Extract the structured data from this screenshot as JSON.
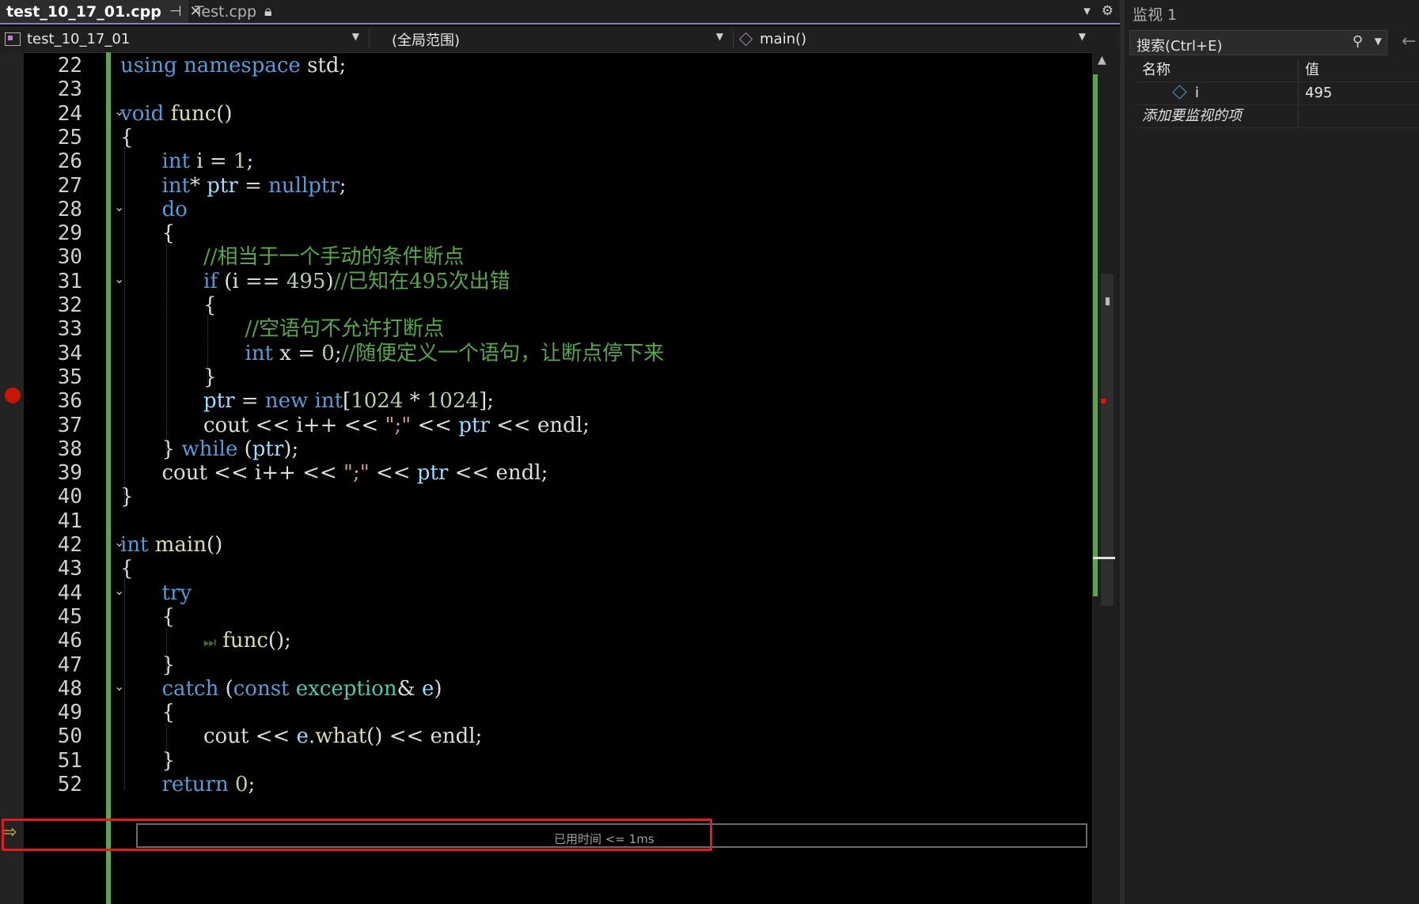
{
  "tabs": [
    {
      "label": "test_10_17_01.cpp",
      "icons": [
        "pin-icon",
        "close-icon"
      ]
    },
    {
      "label": "Test.cpp",
      "icons": [
        "lock-icon"
      ]
    }
  ],
  "navbar": {
    "project": "test_10_17_01",
    "scope": "(全局范围)",
    "function": "main()"
  },
  "code_lines": [
    {
      "n": "22",
      "text": "using namespace std;"
    },
    {
      "n": "23",
      "text": ""
    },
    {
      "n": "24",
      "text": "void func()"
    },
    {
      "n": "25",
      "text": "{"
    },
    {
      "n": "26",
      "text": "int i = 1;"
    },
    {
      "n": "27",
      "text": "int* ptr = nullptr;"
    },
    {
      "n": "28",
      "text": "do"
    },
    {
      "n": "29",
      "text": "{"
    },
    {
      "n": "30",
      "text": "//相当于一个手动的条件断点"
    },
    {
      "n": "31",
      "text": "if (i == 495)//已知在495次出错"
    },
    {
      "n": "32",
      "text": "{"
    },
    {
      "n": "33",
      "text": "//空语句不允许打断点"
    },
    {
      "n": "34",
      "text": "int x = 0;//随便定义一个语句，让断点停下来"
    },
    {
      "n": "35",
      "text": "}"
    },
    {
      "n": "36",
      "text": "ptr = new int[1024 * 1024];"
    },
    {
      "n": "37",
      "text": "cout << i++ << \";\" << ptr << endl;"
    },
    {
      "n": "38",
      "text": "} while (ptr);"
    },
    {
      "n": "39",
      "text": "cout << i++ << \";\" << ptr << endl;"
    },
    {
      "n": "40",
      "text": "}"
    },
    {
      "n": "41",
      "text": ""
    },
    {
      "n": "42",
      "text": "int main()"
    },
    {
      "n": "43",
      "text": "{"
    },
    {
      "n": "44",
      "text": "try"
    },
    {
      "n": "45",
      "text": "{"
    },
    {
      "n": "46",
      "text": "func();"
    },
    {
      "n": "47",
      "text": "}"
    },
    {
      "n": "48",
      "text": "catch (const exception& e)"
    },
    {
      "n": "49",
      "text": "{"
    },
    {
      "n": "50",
      "text": "cout << e.what() << endl;"
    },
    {
      "n": "51",
      "text": "}"
    },
    {
      "n": "52",
      "text": "return 0;"
    }
  ],
  "perf_tip": "已用时间 <= 1ms",
  "watch": {
    "title": "监视 1",
    "search_placeholder": "搜索(Ctrl+E)",
    "col_name": "名称",
    "col_value": "值",
    "rows": [
      {
        "name": "i",
        "value": "495"
      }
    ],
    "add_item": "添加要监视的项"
  },
  "colors": {
    "keyword": "#569cd6",
    "type": "#4ec9b0",
    "comment": "#57a64a",
    "function": "#dcdcaa",
    "number": "#b5cea8",
    "string": "#d69d85",
    "breakpoint": "#e51400",
    "highlight_box": "#e11b22",
    "tab_accent": "#8e7cc3"
  }
}
